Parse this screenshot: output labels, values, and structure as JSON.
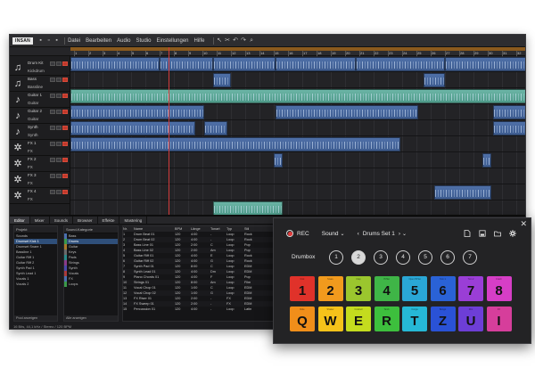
{
  "app": {
    "logo": "INSAN",
    "menus": [
      "Datei",
      "Bearbeiten",
      "Audio",
      "Studio",
      "Einstellungen",
      "Hilfe"
    ]
  },
  "tracks": [
    {
      "icon": "speaker",
      "name": "Drum Kit",
      "sub": "Kickdrum"
    },
    {
      "icon": "speaker",
      "name": "Bass",
      "sub": "Bassline"
    },
    {
      "icon": "guitar",
      "name": "Guitar 1",
      "sub": "Guitar"
    },
    {
      "icon": "guitar",
      "name": "Guitar 2",
      "sub": "Guitar"
    },
    {
      "icon": "guitar",
      "name": "Synth",
      "sub": "Synth"
    },
    {
      "icon": "gear",
      "name": "FX 1",
      "sub": "FX"
    },
    {
      "icon": "gear",
      "name": "FX 2",
      "sub": "FX"
    },
    {
      "icon": "gear",
      "name": "FX 3",
      "sub": "FX"
    },
    {
      "icon": "gear",
      "name": "FX 4",
      "sub": "FX"
    }
  ],
  "ruler_numbers": [
    "1",
    "2",
    "3",
    "4",
    "5",
    "6",
    "7",
    "8",
    "9",
    "10",
    "11",
    "12",
    "13",
    "14",
    "15",
    "16",
    "17",
    "18",
    "19",
    "20",
    "21",
    "22",
    "23",
    "24",
    "25",
    "26",
    "27",
    "28",
    "29",
    "30",
    "31",
    "32"
  ],
  "lower": {
    "tabs": [
      "Editor",
      "Mixer",
      "Sounds",
      "Browser",
      "Effekte",
      "Mastering"
    ],
    "pane1": {
      "title": "Projekt",
      "rows": [
        "Sounds",
        "Drumset Kick 1",
        "Drumset Snare 1",
        "Bassline 1",
        "Guitar Riff 1",
        "Guitar Riff 2",
        "Synth Pad 1",
        "Synth Lead 1",
        "Vocals 1",
        "Vocals 2"
      ],
      "foot": "Pool anzeigen"
    },
    "pane2": {
      "title": "Sound-Kategorie",
      "rows": [
        "Bass",
        "Drums",
        "Guitar",
        "Keys",
        "Pads",
        "Strings",
        "Synth",
        "Vocals",
        "FX",
        "Loops"
      ],
      "foot": "Alle anzeigen"
    },
    "browser": {
      "columns": [
        "Nr.",
        "Name",
        "BPM",
        "Länge",
        "Tonart",
        "Typ",
        "Stil"
      ],
      "rows": [
        [
          "1",
          "Drum Beat 01",
          "120",
          "4:00",
          "-",
          "Loop",
          "Rock"
        ],
        [
          "2",
          "Drum Beat 02",
          "120",
          "4:00",
          "-",
          "Loop",
          "Rock"
        ],
        [
          "3",
          "Bass Line 01",
          "120",
          "2:00",
          "C",
          "Loop",
          "Pop"
        ],
        [
          "4",
          "Bass Line 02",
          "120",
          "2:00",
          "Am",
          "Loop",
          "Pop"
        ],
        [
          "5",
          "Guitar Riff 01",
          "120",
          "4:00",
          "E",
          "Loop",
          "Rock"
        ],
        [
          "6",
          "Guitar Riff 02",
          "120",
          "4:00",
          "G",
          "Loop",
          "Rock"
        ],
        [
          "7",
          "Synth Pad 01",
          "120",
          "8:00",
          "C",
          "Loop",
          "EDM"
        ],
        [
          "8",
          "Synth Lead 01",
          "120",
          "4:00",
          "Dm",
          "Loop",
          "EDM"
        ],
        [
          "9",
          "Piano Chords 01",
          "120",
          "4:00",
          "F",
          "Loop",
          "Pop"
        ],
        [
          "10",
          "Strings 01",
          "120",
          "8:00",
          "Am",
          "Loop",
          "Film"
        ],
        [
          "11",
          "Vocal Chop 01",
          "120",
          "1:00",
          "C",
          "Loop",
          "EDM"
        ],
        [
          "12",
          "Vocal Chop 02",
          "120",
          "1:00",
          "G",
          "Loop",
          "EDM"
        ],
        [
          "13",
          "FX Riser 01",
          "120",
          "2:00",
          "-",
          "FX",
          "EDM"
        ],
        [
          "14",
          "FX Sweep 01",
          "120",
          "2:00",
          "-",
          "FX",
          "EDM"
        ],
        [
          "15",
          "Percussion 01",
          "120",
          "4:00",
          "-",
          "Loop",
          "Latin"
        ]
      ]
    },
    "status": "16 Bits, 44,1 kHz / Stereo / 120 BPM"
  },
  "macro": {
    "rec_label": "REC",
    "sound_label": "Sound",
    "preset_label": "Drums Set 1",
    "count_label": "Drumbox",
    "numbers": [
      "1",
      "2",
      "3",
      "4",
      "5",
      "6",
      "7"
    ],
    "active_number": 2,
    "pads": [
      {
        "key": "1",
        "color": "#e0322a",
        "label": "Kick"
      },
      {
        "key": "2",
        "color": "#f19a1d",
        "label": "Snare"
      },
      {
        "key": "3",
        "color": "#9bc62e",
        "label": "Clap"
      },
      {
        "key": "4",
        "color": "#3fb547",
        "label": "HiHat"
      },
      {
        "key": "5",
        "color": "#2aa7d6",
        "label": "Open HiHat"
      },
      {
        "key": "6",
        "color": "#2a62d6",
        "label": "Tom 1"
      },
      {
        "key": "7",
        "color": "#9a3ed6",
        "label": "Tom 2"
      },
      {
        "key": "8",
        "color": "#d63ec6",
        "label": "Crash"
      },
      {
        "key": "Q",
        "color": "#f08e1a",
        "label": "Ride"
      },
      {
        "key": "W",
        "color": "#f5c21a",
        "label": "Shaker"
      },
      {
        "key": "E",
        "color": "#c4dc1e",
        "label": "Cowbell"
      },
      {
        "key": "R",
        "color": "#3dbf3d",
        "label": "Tamb"
      },
      {
        "key": "T",
        "color": "#26b8d6",
        "label": "Conga"
      },
      {
        "key": "Z",
        "color": "#2a52d6",
        "label": "Bongo"
      },
      {
        "key": "U",
        "color": "#6d3ed6",
        "label": "Rim"
      },
      {
        "key": "I",
        "color": "#d63e9b",
        "label": "FX"
      }
    ]
  }
}
